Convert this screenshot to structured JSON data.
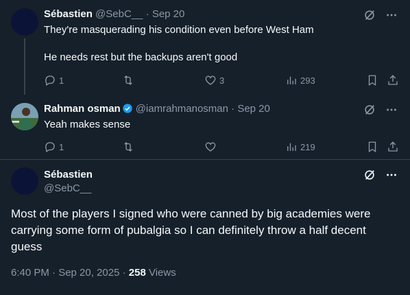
{
  "tweets": [
    {
      "name": "Sébastien",
      "handle": "@SebC__",
      "separator": "·",
      "date": "Sep 20",
      "line1": "They're masquerading his condition even before West Ham",
      "line2": "He needs rest but the backups aren't good",
      "replies": "1",
      "retweets": "",
      "likes": "3",
      "views": "293"
    },
    {
      "name": "Rahman osman",
      "handle": "@iamrahmanosman",
      "separator": "·",
      "date": "Sep 20",
      "line1": "Yeah makes sense",
      "replies": "1",
      "retweets": "",
      "likes": "",
      "views": "219"
    }
  ],
  "main_tweet": {
    "name": "Sébastien",
    "handle": "@SebC__",
    "text": "Most of the players I signed who were canned by big academies were carrying some form of pubalgia so I can definitely throw a half decent guess",
    "timestamp": "6:40 PM · Sep 20, 2025 · ",
    "views_count": "258",
    "views_label": " Views"
  },
  "icons": {
    "reply": "reply-icon",
    "retweet": "retweet-icon",
    "like": "heart-icon",
    "views": "views-chart-icon",
    "bookmark": "bookmark-icon",
    "share": "share-icon",
    "grok": "grok-icon",
    "more": "more-dots-icon",
    "verified": "verified-badge-icon"
  },
  "colors": {
    "background": "#15202b",
    "secondary_text": "#8b98a5",
    "verified_blue": "#1d9bf0",
    "divider": "#38444d"
  }
}
